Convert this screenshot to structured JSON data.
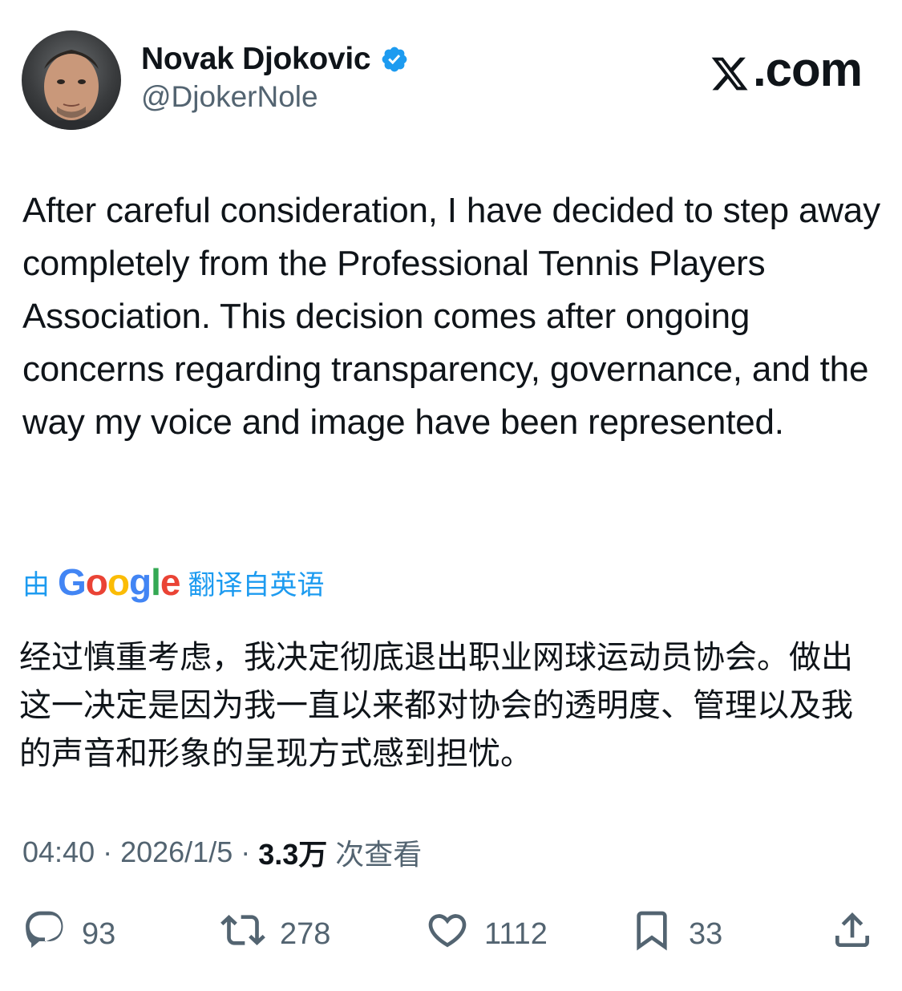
{
  "author": {
    "display_name": "Novak Djokovic",
    "handle": "@DjokerNole",
    "verified": true
  },
  "brand": {
    "label": ".com",
    "logo": "x-logo"
  },
  "tweet": {
    "text": "After careful consideration, I have decided to step away completely from the Professional Tennis Players Association. This decision comes after ongoing concerns regarding transparency, governance, and the way my voice and image have been represented."
  },
  "translation": {
    "prefix": "由",
    "provider": "Google",
    "suffix": "翻译自英语",
    "text": "经过慎重考虑，我决定彻底退出职业网球运动员协会。做出这一决定是因为我一直以来都对协会的透明度、管理以及我的声音和形象的呈现方式感到担忧。"
  },
  "meta": {
    "time": "04:40",
    "separator": "·",
    "date": "2026/1/5",
    "views_count": "3.3万",
    "views_label": "次查看"
  },
  "actions": {
    "replies": "93",
    "reposts": "278",
    "likes": "1112",
    "bookmarks": "33"
  },
  "colors": {
    "accent": "#1d9bf0",
    "text": "#0f1419",
    "secondary": "#536471"
  }
}
